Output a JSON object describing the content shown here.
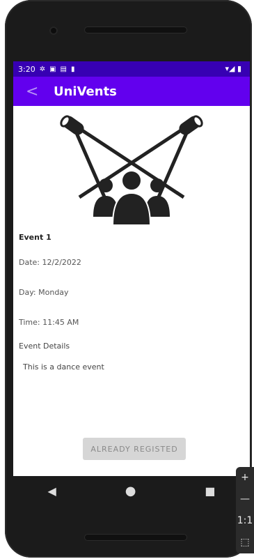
{
  "status_bar": {
    "time": "3:20",
    "left_icons": [
      "settings-gear",
      "calendar-31",
      "notification",
      "sd-card"
    ],
    "right_icons": "▾◢ ▮"
  },
  "app_bar": {
    "back_symbol": "<",
    "title": "UniVents"
  },
  "event": {
    "name": "Event 1",
    "date_text": "Date:  12/2/2022",
    "day_text": "Day:  Monday",
    "time_text": "Time:   11:45 AM",
    "details_heading": "Event Details",
    "details_text": "This is a dance event"
  },
  "register_button": {
    "label": "ALREADY REGISTED"
  },
  "nav": {
    "back": "◀",
    "home": "●",
    "recent": "■"
  },
  "emulator_panel": {
    "zoom_in": "+",
    "zoom_out": "—",
    "ratio": "1:1",
    "fit": "⬚"
  },
  "colors": {
    "status_bar": "#3700b3",
    "app_bar": "#6200ee",
    "button_bg": "#d6d6d6",
    "button_text": "#8a8a8a"
  }
}
